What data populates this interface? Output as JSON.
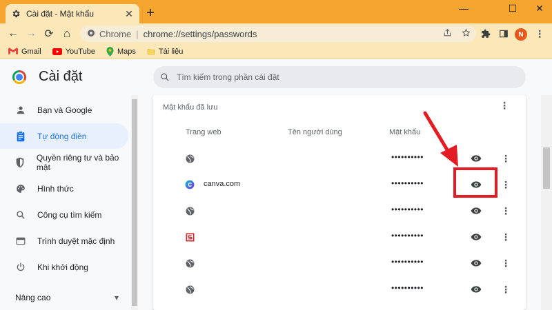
{
  "tab": {
    "title": "Cài đặt - Mật khẩu",
    "close": "✕",
    "new_tab": "+"
  },
  "window": {
    "minimize": "—",
    "maximize": "☐",
    "close": "✕"
  },
  "toolbar": {
    "back": "←",
    "forward": "→",
    "reload": "⟳",
    "home": "⌂",
    "site_label": "Chrome",
    "separator": "|",
    "url": "chrome://settings/passwords",
    "profile_initial": "N",
    "menu": "⋮"
  },
  "bookmarks": [
    {
      "label": "Gmail",
      "icon": "gmail-icon"
    },
    {
      "label": "YouTube",
      "icon": "youtube-icon"
    },
    {
      "label": "Maps",
      "icon": "maps-icon"
    },
    {
      "label": "Tài liệu",
      "icon": "folder-icon"
    }
  ],
  "settings": {
    "title": "Cài đặt",
    "search_placeholder": "Tìm kiếm trong phần cài đặt"
  },
  "sidebar": {
    "items": [
      {
        "label": "Bạn và Google",
        "icon": "person-icon"
      },
      {
        "label": "Tự động điền",
        "icon": "clipboard-icon",
        "active": true
      },
      {
        "label": "Quyền riêng tư và bảo mật",
        "icon": "shield-icon"
      },
      {
        "label": "Hình thức",
        "icon": "palette-icon"
      },
      {
        "label": "Công cụ tìm kiếm",
        "icon": "search-icon"
      },
      {
        "label": "Trình duyệt mặc định",
        "icon": "browser-icon"
      },
      {
        "label": "Khi khởi động",
        "icon": "power-icon"
      }
    ],
    "advanced": "Nâng cao",
    "advanced_arrow": "▾"
  },
  "passwords": {
    "section_title": "Mật khẩu đã lưu",
    "columns": {
      "site": "Trang web",
      "username": "Tên người dùng",
      "password": "Mật khẩu"
    },
    "rows": [
      {
        "site": "",
        "username": "",
        "password": "••••••••••",
        "icon": "globe-icon"
      },
      {
        "site": "canva.com",
        "username": "",
        "password": "••••••••••",
        "icon": "canva-icon"
      },
      {
        "site": "",
        "username": "",
        "password": "••••••••••",
        "icon": "globe-icon"
      },
      {
        "site": "",
        "username": "",
        "password": "••••••••••",
        "icon": "s-logo-icon"
      },
      {
        "site": "",
        "username": "",
        "password": "••••••••••",
        "icon": "globe-icon"
      },
      {
        "site": "",
        "username": "",
        "password": "••••••••••",
        "icon": "globe-icon"
      }
    ],
    "more": "⋮"
  },
  "colors": {
    "tab_strip": "#f5a52e",
    "toolbar": "#fbe7b8",
    "accent": "#1a73e8",
    "annotation": "#e31b23"
  }
}
